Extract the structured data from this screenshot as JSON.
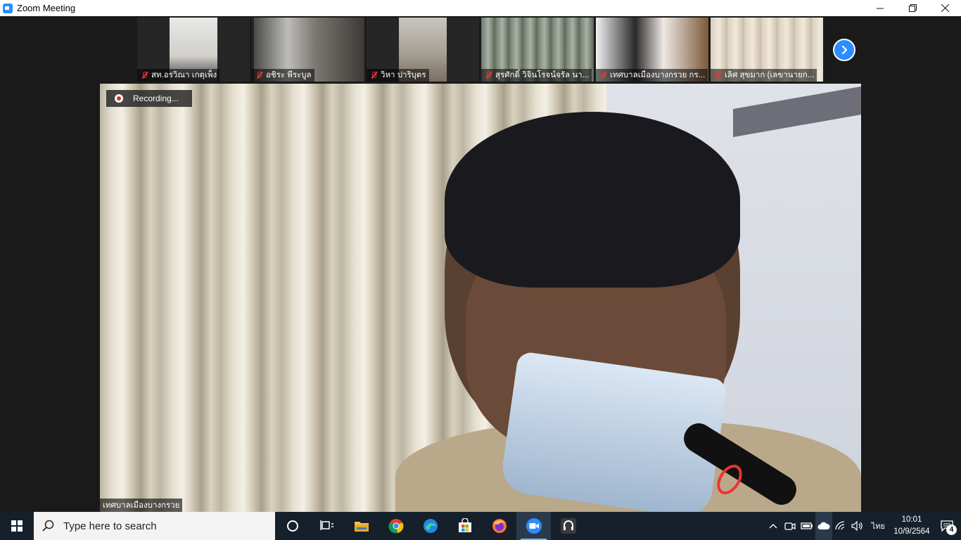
{
  "window": {
    "title": "Zoom Meeting",
    "icon": "zoom-app-icon",
    "controls": [
      "minimize",
      "restore",
      "close"
    ]
  },
  "meeting": {
    "participants": [
      {
        "name": "สท.อรวิณา เกตุเพ็ง",
        "muted": true
      },
      {
        "name": "อชิระ พีระบูล",
        "muted": true
      },
      {
        "name": "วิหา ปาริบุตร",
        "muted": true
      },
      {
        "name": "สุรศักดิ์ วิจินโรจน์จรัล นา...",
        "muted": true
      },
      {
        "name": "เทศบาลเมืองบางกรวย กร...",
        "muted": true
      },
      {
        "name": "เลิศ สุขมาก (เลขานายก...",
        "muted": true
      }
    ],
    "next_icon": "chevron-right-icon",
    "recording_label": "Recording...",
    "main_speaker_label": "เทศบาลเมืองบางกรวย"
  },
  "taskbar": {
    "search_placeholder": "Type here to search",
    "pinned": [
      "cortana-icon",
      "task-view-icon",
      "file-explorer-icon",
      "chrome-icon",
      "edge-icon",
      "store-icon",
      "firefox-icon",
      "zoom-icon",
      "headset-app-icon"
    ],
    "active_app": "zoom-icon",
    "language": "ไทย",
    "time": "10:01",
    "date": "10/9/2564",
    "notification_count": "4"
  }
}
